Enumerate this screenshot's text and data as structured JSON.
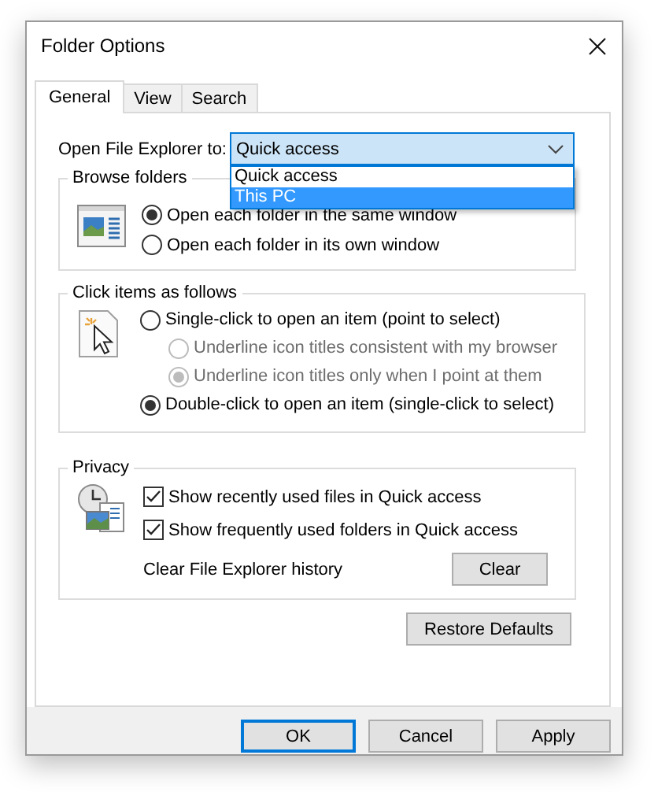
{
  "window": {
    "title": "Folder Options"
  },
  "tabs": [
    {
      "label": "General",
      "selected": true
    },
    {
      "label": "View",
      "selected": false
    },
    {
      "label": "Search",
      "selected": false
    }
  ],
  "open_to": {
    "label": "Open File Explorer to:",
    "value": "Quick access",
    "expanded": true,
    "options": [
      {
        "label": "Quick access",
        "highlighted": false
      },
      {
        "label": "This PC",
        "highlighted": true
      }
    ]
  },
  "groups": [
    {
      "title": "Browse folders",
      "options": [
        {
          "kind": "radio",
          "label": "Open each folder in the same window",
          "checked": true,
          "disabled": false
        },
        {
          "kind": "radio",
          "label": "Open each folder in its own window",
          "checked": false,
          "disabled": false
        }
      ]
    },
    {
      "title": "Click items as follows",
      "options": [
        {
          "kind": "radio",
          "label": "Single-click to open an item (point to select)",
          "checked": false,
          "disabled": false,
          "children": [
            {
              "kind": "radio",
              "label": "Underline icon titles consistent with my browser",
              "checked": false,
              "disabled": true
            },
            {
              "kind": "radio",
              "label": "Underline icon titles only when I point at them",
              "checked": true,
              "disabled": true
            }
          ]
        },
        {
          "kind": "radio",
          "label": "Double-click to open an item (single-click to select)",
          "checked": true,
          "disabled": false
        }
      ]
    },
    {
      "title": "Privacy",
      "options": [
        {
          "kind": "checkbox",
          "label": "Show recently used files in Quick access",
          "checked": true,
          "disabled": false
        },
        {
          "kind": "checkbox",
          "label": "Show frequently used folders in Quick access",
          "checked": true,
          "disabled": false
        }
      ],
      "action": {
        "label": "Clear File Explorer history",
        "button": "Clear"
      }
    }
  ],
  "restore_button": "Restore Defaults",
  "footer_buttons": [
    {
      "label": "OK",
      "default": true
    },
    {
      "label": "Cancel",
      "default": false
    },
    {
      "label": "Apply",
      "default": false
    }
  ]
}
